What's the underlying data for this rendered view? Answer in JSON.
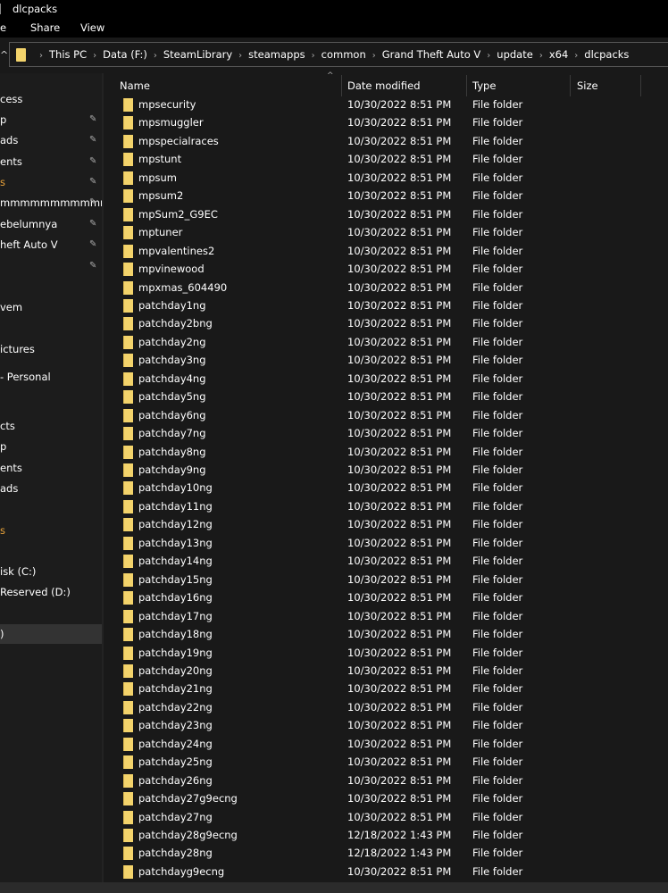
{
  "window": {
    "title": "dlcpacks"
  },
  "ribbon": {
    "tabs": [
      "e",
      "Share",
      "View"
    ]
  },
  "address": {
    "crumbs": [
      "This PC",
      "Data (F:)",
      "SteamLibrary",
      "steamapps",
      "common",
      "Grand Theft Auto V",
      "update",
      "x64",
      "dlcpacks"
    ]
  },
  "sidebar": {
    "items": [
      {
        "label": "cess",
        "pinned": false
      },
      {
        "label": "p",
        "pinned": true
      },
      {
        "label": "ads",
        "pinned": true
      },
      {
        "label": "ents",
        "pinned": true
      },
      {
        "label": "s",
        "pinned": true,
        "color": "orange"
      },
      {
        "label": "mmmmmmmmmmr",
        "pinned": true
      },
      {
        "label": "ebelumnya",
        "pinned": true
      },
      {
        "label": "heft Auto V",
        "pinned": true
      },
      {
        "label": "",
        "pinned": true
      },
      {
        "label": "vem",
        "pinned": false
      },
      {
        "label": "ictures",
        "pinned": false
      },
      {
        "label": " - Personal",
        "pinned": false
      },
      {
        "label": "cts",
        "pinned": false
      },
      {
        "label": "p",
        "pinned": false
      },
      {
        "label": "ents",
        "pinned": false
      },
      {
        "label": "ads",
        "pinned": false
      },
      {
        "label": "s",
        "pinned": false,
        "color": "orange"
      },
      {
        "label": "isk (C:)",
        "pinned": false
      },
      {
        "label": "Reserved (D:)",
        "pinned": false
      },
      {
        "label": ")",
        "pinned": false,
        "selected": true
      }
    ]
  },
  "columns": {
    "name": "Name",
    "date": "Date modified",
    "type": "Type",
    "size": "Size"
  },
  "files": [
    {
      "name": "mpsecurity",
      "date": "10/30/2022 8:51 PM",
      "type": "File folder"
    },
    {
      "name": "mpsmuggler",
      "date": "10/30/2022 8:51 PM",
      "type": "File folder"
    },
    {
      "name": "mpspecialraces",
      "date": "10/30/2022 8:51 PM",
      "type": "File folder"
    },
    {
      "name": "mpstunt",
      "date": "10/30/2022 8:51 PM",
      "type": "File folder"
    },
    {
      "name": "mpsum",
      "date": "10/30/2022 8:51 PM",
      "type": "File folder"
    },
    {
      "name": "mpsum2",
      "date": "10/30/2022 8:51 PM",
      "type": "File folder"
    },
    {
      "name": "mpSum2_G9EC",
      "date": "10/30/2022 8:51 PM",
      "type": "File folder"
    },
    {
      "name": "mptuner",
      "date": "10/30/2022 8:51 PM",
      "type": "File folder"
    },
    {
      "name": "mpvalentines2",
      "date": "10/30/2022 8:51 PM",
      "type": "File folder"
    },
    {
      "name": "mpvinewood",
      "date": "10/30/2022 8:51 PM",
      "type": "File folder"
    },
    {
      "name": "mpxmas_604490",
      "date": "10/30/2022 8:51 PM",
      "type": "File folder"
    },
    {
      "name": "patchday1ng",
      "date": "10/30/2022 8:51 PM",
      "type": "File folder"
    },
    {
      "name": "patchday2bng",
      "date": "10/30/2022 8:51 PM",
      "type": "File folder"
    },
    {
      "name": "patchday2ng",
      "date": "10/30/2022 8:51 PM",
      "type": "File folder"
    },
    {
      "name": "patchday3ng",
      "date": "10/30/2022 8:51 PM",
      "type": "File folder"
    },
    {
      "name": "patchday4ng",
      "date": "10/30/2022 8:51 PM",
      "type": "File folder"
    },
    {
      "name": "patchday5ng",
      "date": "10/30/2022 8:51 PM",
      "type": "File folder"
    },
    {
      "name": "patchday6ng",
      "date": "10/30/2022 8:51 PM",
      "type": "File folder"
    },
    {
      "name": "patchday7ng",
      "date": "10/30/2022 8:51 PM",
      "type": "File folder"
    },
    {
      "name": "patchday8ng",
      "date": "10/30/2022 8:51 PM",
      "type": "File folder"
    },
    {
      "name": "patchday9ng",
      "date": "10/30/2022 8:51 PM",
      "type": "File folder"
    },
    {
      "name": "patchday10ng",
      "date": "10/30/2022 8:51 PM",
      "type": "File folder"
    },
    {
      "name": "patchday11ng",
      "date": "10/30/2022 8:51 PM",
      "type": "File folder"
    },
    {
      "name": "patchday12ng",
      "date": "10/30/2022 8:51 PM",
      "type": "File folder"
    },
    {
      "name": "patchday13ng",
      "date": "10/30/2022 8:51 PM",
      "type": "File folder"
    },
    {
      "name": "patchday14ng",
      "date": "10/30/2022 8:51 PM",
      "type": "File folder"
    },
    {
      "name": "patchday15ng",
      "date": "10/30/2022 8:51 PM",
      "type": "File folder"
    },
    {
      "name": "patchday16ng",
      "date": "10/30/2022 8:51 PM",
      "type": "File folder"
    },
    {
      "name": "patchday17ng",
      "date": "10/30/2022 8:51 PM",
      "type": "File folder"
    },
    {
      "name": "patchday18ng",
      "date": "10/30/2022 8:51 PM",
      "type": "File folder"
    },
    {
      "name": "patchday19ng",
      "date": "10/30/2022 8:51 PM",
      "type": "File folder"
    },
    {
      "name": "patchday20ng",
      "date": "10/30/2022 8:51 PM",
      "type": "File folder"
    },
    {
      "name": "patchday21ng",
      "date": "10/30/2022 8:51 PM",
      "type": "File folder"
    },
    {
      "name": "patchday22ng",
      "date": "10/30/2022 8:51 PM",
      "type": "File folder"
    },
    {
      "name": "patchday23ng",
      "date": "10/30/2022 8:51 PM",
      "type": "File folder"
    },
    {
      "name": "patchday24ng",
      "date": "10/30/2022 8:51 PM",
      "type": "File folder"
    },
    {
      "name": "patchday25ng",
      "date": "10/30/2022 8:51 PM",
      "type": "File folder"
    },
    {
      "name": "patchday26ng",
      "date": "10/30/2022 8:51 PM",
      "type": "File folder"
    },
    {
      "name": "patchday27g9ecng",
      "date": "10/30/2022 8:51 PM",
      "type": "File folder"
    },
    {
      "name": "patchday27ng",
      "date": "10/30/2022 8:51 PM",
      "type": "File folder"
    },
    {
      "name": "patchday28g9ecng",
      "date": "12/18/2022 1:43 PM",
      "type": "File folder"
    },
    {
      "name": "patchday28ng",
      "date": "12/18/2022 1:43 PM",
      "type": "File folder"
    },
    {
      "name": "patchdayg9ecng",
      "date": "10/30/2022 8:51 PM",
      "type": "File folder"
    }
  ],
  "colors": {
    "folder": "#f3d36b",
    "accent_orange": "#e8a23a",
    "background": "#191919"
  }
}
